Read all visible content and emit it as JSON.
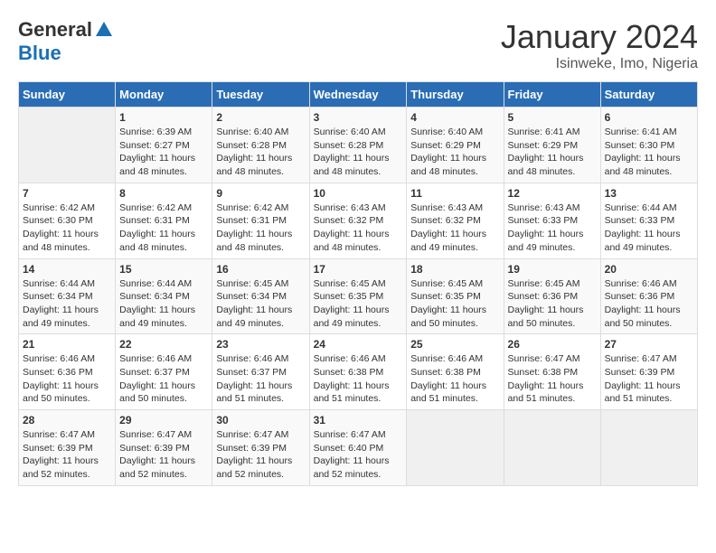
{
  "header": {
    "logo_general": "General",
    "logo_blue": "Blue",
    "month": "January 2024",
    "location": "Isinweke, Imo, Nigeria"
  },
  "days_of_week": [
    "Sunday",
    "Monday",
    "Tuesday",
    "Wednesday",
    "Thursday",
    "Friday",
    "Saturday"
  ],
  "weeks": [
    [
      {
        "day": "",
        "content": ""
      },
      {
        "day": "1",
        "content": "Sunrise: 6:39 AM\nSunset: 6:27 PM\nDaylight: 11 hours and 48 minutes."
      },
      {
        "day": "2",
        "content": "Sunrise: 6:40 AM\nSunset: 6:28 PM\nDaylight: 11 hours and 48 minutes."
      },
      {
        "day": "3",
        "content": "Sunrise: 6:40 AM\nSunset: 6:28 PM\nDaylight: 11 hours and 48 minutes."
      },
      {
        "day": "4",
        "content": "Sunrise: 6:40 AM\nSunset: 6:29 PM\nDaylight: 11 hours and 48 minutes."
      },
      {
        "day": "5",
        "content": "Sunrise: 6:41 AM\nSunset: 6:29 PM\nDaylight: 11 hours and 48 minutes."
      },
      {
        "day": "6",
        "content": "Sunrise: 6:41 AM\nSunset: 6:30 PM\nDaylight: 11 hours and 48 minutes."
      }
    ],
    [
      {
        "day": "7",
        "content": "Sunrise: 6:42 AM\nSunset: 6:30 PM\nDaylight: 11 hours and 48 minutes."
      },
      {
        "day": "8",
        "content": "Sunrise: 6:42 AM\nSunset: 6:31 PM\nDaylight: 11 hours and 48 minutes."
      },
      {
        "day": "9",
        "content": "Sunrise: 6:42 AM\nSunset: 6:31 PM\nDaylight: 11 hours and 48 minutes."
      },
      {
        "day": "10",
        "content": "Sunrise: 6:43 AM\nSunset: 6:32 PM\nDaylight: 11 hours and 48 minutes."
      },
      {
        "day": "11",
        "content": "Sunrise: 6:43 AM\nSunset: 6:32 PM\nDaylight: 11 hours and 49 minutes."
      },
      {
        "day": "12",
        "content": "Sunrise: 6:43 AM\nSunset: 6:33 PM\nDaylight: 11 hours and 49 minutes."
      },
      {
        "day": "13",
        "content": "Sunrise: 6:44 AM\nSunset: 6:33 PM\nDaylight: 11 hours and 49 minutes."
      }
    ],
    [
      {
        "day": "14",
        "content": "Sunrise: 6:44 AM\nSunset: 6:34 PM\nDaylight: 11 hours and 49 minutes."
      },
      {
        "day": "15",
        "content": "Sunrise: 6:44 AM\nSunset: 6:34 PM\nDaylight: 11 hours and 49 minutes."
      },
      {
        "day": "16",
        "content": "Sunrise: 6:45 AM\nSunset: 6:34 PM\nDaylight: 11 hours and 49 minutes."
      },
      {
        "day": "17",
        "content": "Sunrise: 6:45 AM\nSunset: 6:35 PM\nDaylight: 11 hours and 49 minutes."
      },
      {
        "day": "18",
        "content": "Sunrise: 6:45 AM\nSunset: 6:35 PM\nDaylight: 11 hours and 50 minutes."
      },
      {
        "day": "19",
        "content": "Sunrise: 6:45 AM\nSunset: 6:36 PM\nDaylight: 11 hours and 50 minutes."
      },
      {
        "day": "20",
        "content": "Sunrise: 6:46 AM\nSunset: 6:36 PM\nDaylight: 11 hours and 50 minutes."
      }
    ],
    [
      {
        "day": "21",
        "content": "Sunrise: 6:46 AM\nSunset: 6:36 PM\nDaylight: 11 hours and 50 minutes."
      },
      {
        "day": "22",
        "content": "Sunrise: 6:46 AM\nSunset: 6:37 PM\nDaylight: 11 hours and 50 minutes."
      },
      {
        "day": "23",
        "content": "Sunrise: 6:46 AM\nSunset: 6:37 PM\nDaylight: 11 hours and 51 minutes."
      },
      {
        "day": "24",
        "content": "Sunrise: 6:46 AM\nSunset: 6:38 PM\nDaylight: 11 hours and 51 minutes."
      },
      {
        "day": "25",
        "content": "Sunrise: 6:46 AM\nSunset: 6:38 PM\nDaylight: 11 hours and 51 minutes."
      },
      {
        "day": "26",
        "content": "Sunrise: 6:47 AM\nSunset: 6:38 PM\nDaylight: 11 hours and 51 minutes."
      },
      {
        "day": "27",
        "content": "Sunrise: 6:47 AM\nSunset: 6:39 PM\nDaylight: 11 hours and 51 minutes."
      }
    ],
    [
      {
        "day": "28",
        "content": "Sunrise: 6:47 AM\nSunset: 6:39 PM\nDaylight: 11 hours and 52 minutes."
      },
      {
        "day": "29",
        "content": "Sunrise: 6:47 AM\nSunset: 6:39 PM\nDaylight: 11 hours and 52 minutes."
      },
      {
        "day": "30",
        "content": "Sunrise: 6:47 AM\nSunset: 6:39 PM\nDaylight: 11 hours and 52 minutes."
      },
      {
        "day": "31",
        "content": "Sunrise: 6:47 AM\nSunset: 6:40 PM\nDaylight: 11 hours and 52 minutes."
      },
      {
        "day": "",
        "content": ""
      },
      {
        "day": "",
        "content": ""
      },
      {
        "day": "",
        "content": ""
      }
    ]
  ]
}
